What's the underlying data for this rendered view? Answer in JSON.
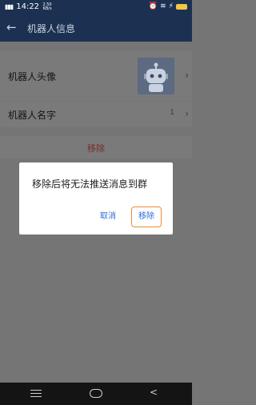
{
  "status_bar": {
    "signal": "4G",
    "time": "14:22",
    "net_speed": "2.50 KB/s",
    "icons": [
      "alarm-icon",
      "wifi-icon",
      "bolt-icon",
      "battery-icon"
    ]
  },
  "header": {
    "title": "机器人信息",
    "back_icon": "arrow-left-icon"
  },
  "settings": {
    "avatar_label": "机器人头像",
    "name_label": "机器人名字",
    "name_value": "1",
    "remove_label": "移除"
  },
  "dialog": {
    "message": "移除后将无法推送消息到群",
    "cancel_label": "取消",
    "confirm_label": "移除"
  },
  "colors": {
    "header_bg": "#1c3152",
    "accent_blue": "#2a6ed0",
    "highlight_orange": "#ef8a2f",
    "remove_red": "#c0392b"
  }
}
